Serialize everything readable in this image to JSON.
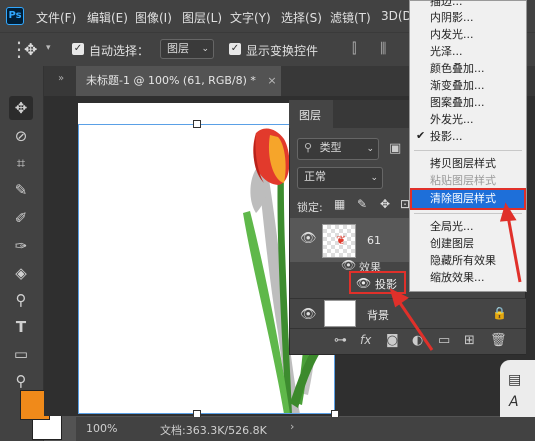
{
  "app": {
    "logo": "Ps"
  },
  "menubar": [
    "文件(F)",
    "编辑(E)",
    "图像(I)",
    "图层(L)",
    "文字(Y)",
    "选择(S)",
    "滤镜(T)",
    "3D(D)"
  ],
  "options": {
    "auto_select_label": "自动选择：",
    "auto_select_value": "图层",
    "show_transform_label": "显示变换控件"
  },
  "document_tab": {
    "title": "未标题-1 @ 100% (61, RGB/8) *",
    "close": "×"
  },
  "status": {
    "zoom": "100%",
    "doc_size": "文档:363.3K/526.8K"
  },
  "layers_panel": {
    "title": "图层",
    "filter_label": "类型",
    "blend_mode": "正常",
    "lock_label": "锁定:",
    "layers": [
      {
        "name": "61",
        "effects_label": "效果",
        "effect_item": "投影"
      },
      {
        "name": "背景"
      }
    ],
    "footer_icons": [
      "link-icon",
      "fx-icon",
      "mask-icon",
      "adjustment-icon",
      "folder-icon",
      "new-layer-icon",
      "trash-icon"
    ],
    "fx_label": "fx"
  },
  "context_menu": {
    "group1": [
      "描边...",
      "内阴影...",
      "内发光...",
      "光泽...",
      "颜色叠加...",
      "渐变叠加...",
      "图案叠加...",
      "外发光...",
      "投影..."
    ],
    "checked_item": "投影...",
    "group2": [
      "拷贝图层样式",
      "粘贴图层样式",
      "清除图层样式"
    ],
    "disabled_item": "粘贴图层样式",
    "highlighted_item": "清除图层样式",
    "group3": [
      "全局光...",
      "创建图层",
      "隐藏所有效果",
      "缩放效果..."
    ]
  },
  "colors": {
    "foreground": "#f08a1a",
    "background": "#ffffff",
    "highlight": "#1e6fd9",
    "annotation": "#e0302a"
  }
}
